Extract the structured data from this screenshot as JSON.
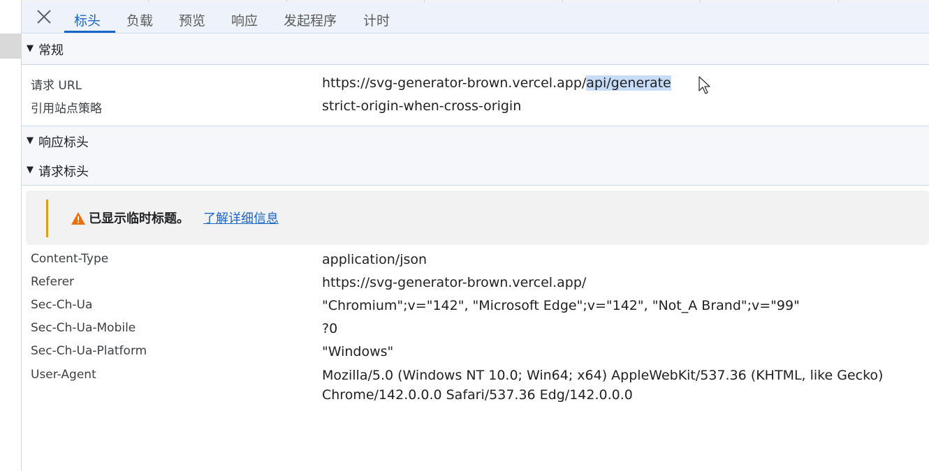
{
  "tabs": {
    "items": [
      {
        "label": "标头"
      },
      {
        "label": "负载"
      },
      {
        "label": "预览"
      },
      {
        "label": "响应"
      },
      {
        "label": "发起程序"
      },
      {
        "label": "计时"
      }
    ],
    "active_index": 0
  },
  "icons": {
    "close": "close-icon",
    "warning": "warning-icon",
    "cursor": "mouse-pointer-icon",
    "expand": "triangle-down-icon"
  },
  "colors": {
    "accent": "#1a66c8",
    "warning": "#e29b15",
    "selection": "#c7dcf6"
  },
  "general": {
    "title": "常规",
    "rows": [
      {
        "key": "请求 URL",
        "value_plain": "https://svg-generator-brown.vercel.app/",
        "value_selected": "api/generate"
      },
      {
        "key": "引用站点策略",
        "value": "strict-origin-when-cross-origin"
      }
    ]
  },
  "response_headers": {
    "title": "响应标头"
  },
  "request_headers": {
    "title": "请求标头",
    "notice": {
      "text": "已显示临时标题。",
      "link": "了解详细信息"
    },
    "rows": [
      {
        "key": "Content-Type",
        "value": "application/json"
      },
      {
        "key": "Referer",
        "value": "https://svg-generator-brown.vercel.app/"
      },
      {
        "key": "Sec-Ch-Ua",
        "value": "\"Chromium\";v=\"142\", \"Microsoft Edge\";v=\"142\", \"Not_A Brand\";v=\"99\""
      },
      {
        "key": "Sec-Ch-Ua-Mobile",
        "value": "?0"
      },
      {
        "key": "Sec-Ch-Ua-Platform",
        "value": "\"Windows\""
      },
      {
        "key": "User-Agent",
        "value_line1": "Mozilla/5.0 (Windows NT 10.0; Win64; x64) AppleWebKit/537.36 (KHTML, like Gecko)",
        "value_line2": "Chrome/142.0.0.0 Safari/537.36 Edg/142.0.0.0"
      }
    ]
  }
}
